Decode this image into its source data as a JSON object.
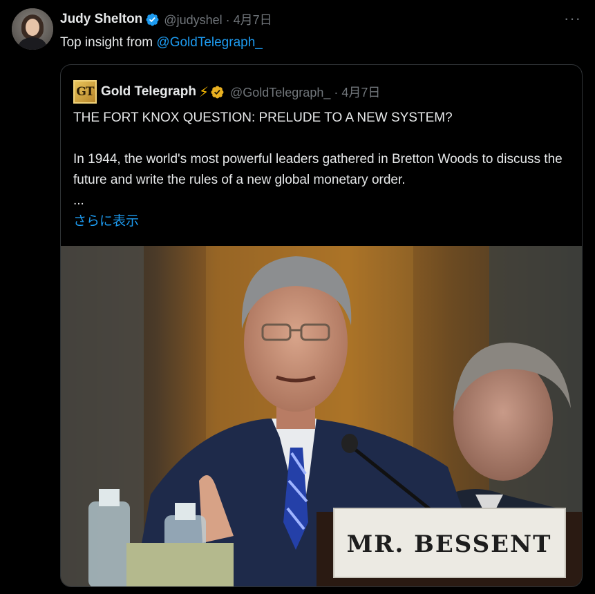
{
  "tweet": {
    "author_name": "Judy Shelton",
    "handle_line": "@judyshel · 4月7日",
    "text_prefix": "Top insight from ",
    "mention": "@GoldTelegraph_",
    "more_label": "···"
  },
  "quote": {
    "logo_text": "GT",
    "author_name": "Gold Telegraph",
    "bolt": "⚡",
    "handle_line": "@GoldTelegraph_ · 4月7日",
    "headline": "THE FORT KNOX QUESTION: PRELUDE TO A NEW SYSTEM?",
    "paragraph": "In 1944, the world's most powerful leaders gathered in Bretton Woods to discuss the future and write the rules of a new global monetary order.",
    "ellipsis": "...",
    "show_more": "さらに表示",
    "image": {
      "nameplate": "MR. BESSENT"
    }
  },
  "colors": {
    "accent": "#1d9bf0",
    "verified_blue": "#1d9bf0",
    "verified_gold": "#e8b021",
    "muted": "#71767b",
    "background": "#000000"
  },
  "icons": {
    "verified": "verified-badge-icon",
    "gold_verified": "gold-verified-badge-icon",
    "more": "more-horizontal-icon"
  }
}
